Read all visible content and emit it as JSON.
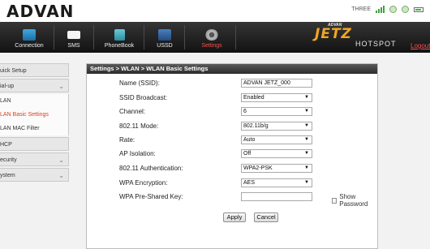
{
  "header": {
    "logo_main": "ADVAN",
    "carrier": "THREE"
  },
  "nav": {
    "tabs": [
      {
        "label": "Connection",
        "icon": "connection-icon"
      },
      {
        "label": "SMS",
        "icon": "envelope-icon"
      },
      {
        "label": "PhoneBook",
        "icon": "phonebook-icon"
      },
      {
        "label": "USSD",
        "icon": "ussd-icon"
      },
      {
        "label": "Settings",
        "icon": "gear-icon",
        "active": true
      }
    ],
    "brand_small": "ADVAN",
    "brand_name": "JETZ",
    "brand_sub": "HOTSPOT",
    "logout": "Logout"
  },
  "sidebar": {
    "items": [
      {
        "label": "uick Setup"
      },
      {
        "label": "ial-up"
      },
      {
        "label": "LAN"
      },
      {
        "label": "LAN Basic Settings"
      },
      {
        "label": "LAN MAC Filter"
      },
      {
        "label": "HCP"
      },
      {
        "label": "ecurity"
      },
      {
        "label": "ystem"
      }
    ]
  },
  "breadcrumb": "Settings > WLAN > WLAN Basic Settings",
  "form": {
    "ssid": {
      "label": "Name (SSID):",
      "value": "ADVAN JETZ_000"
    },
    "ssid_broadcast": {
      "label": "SSID Broadcast:",
      "value": "Enabled"
    },
    "channel": {
      "label": "Channel:",
      "value": "6"
    },
    "mode": {
      "label": "802.11 Mode:",
      "value": "802.11b/g"
    },
    "rate": {
      "label": "Rate:",
      "value": "Auto"
    },
    "ap_isolation": {
      "label": "AP Isolation:",
      "value": "Off"
    },
    "auth": {
      "label": "802.11 Authentication:",
      "value": "WPA2-PSK"
    },
    "encryption": {
      "label": "WPA Encryption:",
      "value": "AES"
    },
    "psk": {
      "label": "WPA Pre-Shared Key:",
      "value": ""
    },
    "show_password": "Show Password",
    "apply": "Apply",
    "cancel": "Cancel"
  },
  "colors": {
    "accent": "#d9401c",
    "nav_bg": "#1a1a1a",
    "brand": "#f0a623"
  }
}
